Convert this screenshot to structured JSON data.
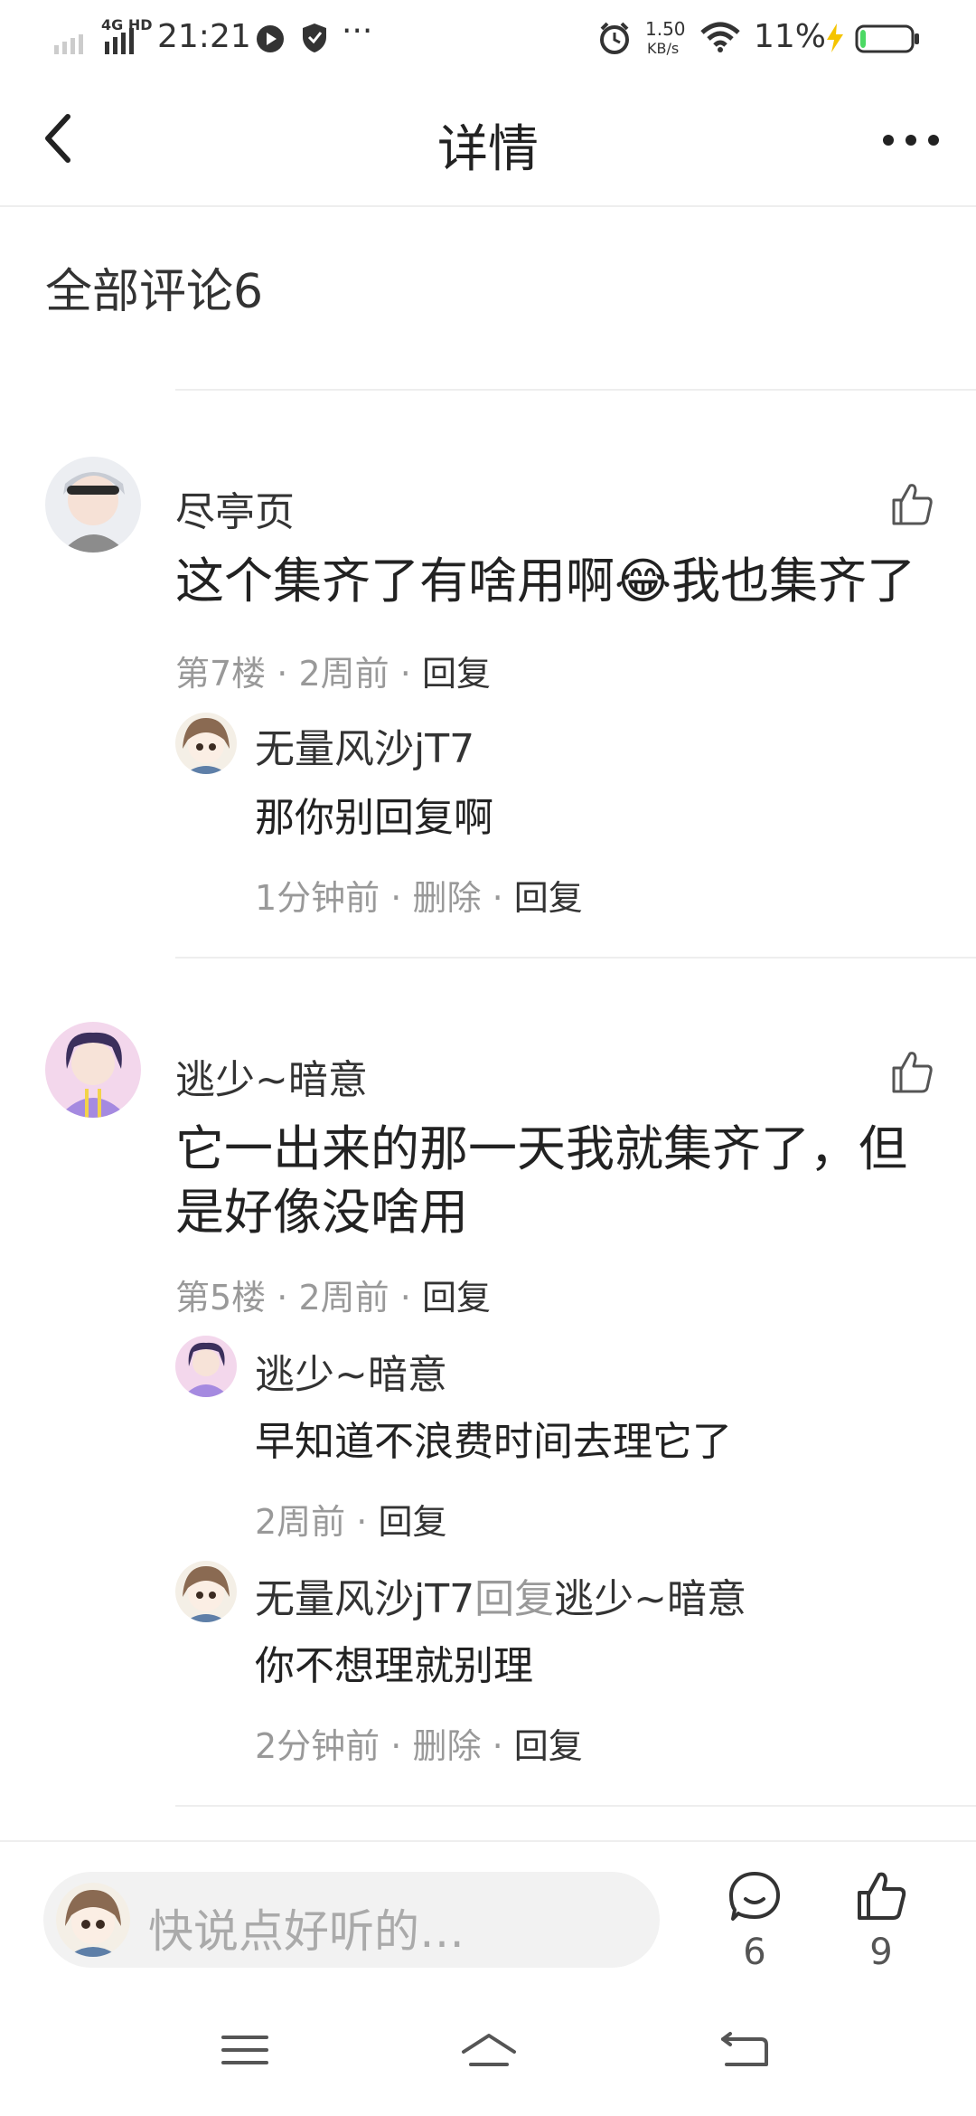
{
  "status_bar": {
    "network": "4G HD",
    "time": "21:21",
    "more": "···",
    "speed_value": "1.50",
    "speed_unit": "KB/s",
    "battery_percent": "11%",
    "battery_level": 0.11
  },
  "header": {
    "title": "详情"
  },
  "comments_section": {
    "title": "全部评论6"
  },
  "comments": [
    {
      "username": "尽亭页",
      "text_before_emoji": "这个集齐了有啥用啊",
      "emoji": "😂",
      "text_after_emoji": "我也集齐了",
      "floor": "第7楼",
      "time": "2周前",
      "reply_label": "回复",
      "replies": [
        {
          "username": "无量风沙jT7",
          "text": "那你别回复啊",
          "time": "1分钟前",
          "delete_label": "删除",
          "reply_label": "回复"
        }
      ]
    },
    {
      "username": "逃少~暗意",
      "text": "它一出来的那一天我就集齐了，但是好像没啥用",
      "floor": "第5楼",
      "time": "2周前",
      "reply_label": "回复",
      "replies": [
        {
          "username": "逃少~暗意",
          "text": "早知道不浪费时间去理它了",
          "time": "2周前",
          "reply_label": "回复"
        },
        {
          "username": "无量风沙jT7",
          "reply_word": "回复",
          "reply_to": "逃少~暗意",
          "text": "你不想理就别理",
          "time": "2分钟前",
          "delete_label": "删除",
          "reply_label": "回复"
        }
      ]
    }
  ],
  "meta_separator": "·",
  "bottom_bar": {
    "input_placeholder": "快说点好听的…",
    "comment_count": "6",
    "like_count": "9"
  },
  "colors": {
    "divider": "#eeeeee",
    "meta": "#999999",
    "text": "#222222",
    "battery_green": "#4cd964",
    "charging": "#f5c400"
  }
}
